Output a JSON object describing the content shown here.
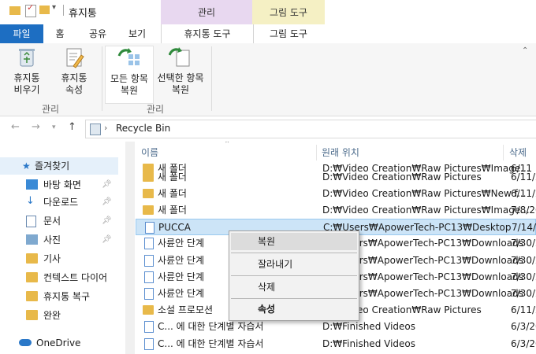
{
  "window": {
    "title": "휴지통"
  },
  "contextual_groups": {
    "manage": "관리",
    "picture_tools": "그림 도구"
  },
  "tabs": [
    {
      "label": "파일"
    },
    {
      "label": "홈"
    },
    {
      "label": "공유"
    },
    {
      "label": "보기"
    },
    {
      "label": "휴지통 도구"
    },
    {
      "label": "그림 도구"
    }
  ],
  "ribbon": {
    "empty_recycle_bin": "휴지통\n비우기",
    "recycle_bin_properties": "휴지통\n속성",
    "restore_all": "모든 항목\n복원",
    "restore_selected": "선택한 항목\n복원",
    "group_manage_1": "관리",
    "group_manage_2": "관리"
  },
  "address": {
    "path": "Recycle Bin"
  },
  "nav": {
    "quick_access": "즐겨찾기",
    "items": [
      {
        "label": "바탕 화면",
        "pinned": true
      },
      {
        "label": "다운로드",
        "pinned": true
      },
      {
        "label": "문서",
        "pinned": true
      },
      {
        "label": "사진",
        "pinned": true
      },
      {
        "label": "기사",
        "pinned": false
      },
      {
        "label": "컨텍스트 다이어",
        "pinned": false
      },
      {
        "label": "휴지통 복구",
        "pinned": false
      },
      {
        "label": "완완",
        "pinned": false
      }
    ],
    "onedrive": "OneDrive"
  },
  "columns": {
    "name": "이름",
    "location": "원래 위치",
    "date": "삭제"
  },
  "rows": [
    {
      "name": "새 폴더",
      "location": "D:₩Video Creation₩Raw Pictures₩Image...",
      "date": "6/11",
      "type": "folder"
    },
    {
      "name": "새 폴더",
      "location": "D:₩Video Creation₩Raw Pictures",
      "date": "6/11/2",
      "type": "folder"
    },
    {
      "name": "새 폴더",
      "location": "D:₩Video Creation₩Raw Pictures₩New f...",
      "date": "6/11/2",
      "type": "folder"
    },
    {
      "name": "새 폴더",
      "location": "D:₩Video Creation₩Raw Pictures₩Image...",
      "date": "7/8/20",
      "type": "folder"
    },
    {
      "name": "PUCCA",
      "location": "C:₩Users₩ApowerTech-PC13₩Desktop",
      "date": "7/14/2",
      "type": "doc",
      "selected": true
    },
    {
      "name": "사륜안 단계",
      "location": "C:₩Users₩ApowerTech-PC13₩Downloads",
      "date": "7/30/2",
      "type": "doc"
    },
    {
      "name": "사륜안 단계",
      "location": "C:₩Users₩ApowerTech-PC13₩Downloads",
      "date": "7/30/2",
      "type": "doc"
    },
    {
      "name": "사륜안 단계",
      "location": "C:₩Users₩ApowerTech-PC13₩Downloads",
      "date": "7/30/2",
      "type": "doc"
    },
    {
      "name": "사륜안 단계",
      "location": "C:₩Users₩ApowerTech-PC13₩Downloads",
      "date": "7/30/2",
      "type": "doc"
    },
    {
      "name": "소설 프로모션",
      "location": "D:₩Video Creation₩Raw Pictures",
      "date": "6/11/2",
      "type": "folder"
    },
    {
      "name": "C... 에 대한 단계별 자습서",
      "location": "D:₩Finished Videos",
      "date": "6/3/20",
      "type": "doc"
    },
    {
      "name": "C... 에 대한 단계별 자습서",
      "location": "D:₩Finished Videos",
      "date": "6/3/20",
      "type": "doc"
    }
  ],
  "context_menu": {
    "restore": "복원",
    "cut": "잘라내기",
    "delete": "삭제",
    "properties": "속성"
  },
  "colors": {
    "file_tab": "#1d6ec2",
    "manage_group": "#e8d8f0",
    "picture_group": "#f5f0c4",
    "selection": "#cce4f7"
  }
}
